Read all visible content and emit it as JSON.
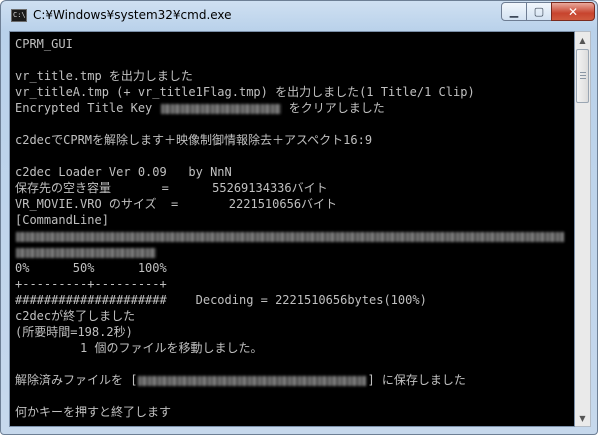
{
  "window": {
    "title": "C:¥Windows¥system32¥cmd.exe",
    "icon_text": "C:\\"
  },
  "controls": {
    "minimize_glyph": "▁",
    "maximize_glyph": "▢",
    "close_glyph": "✕"
  },
  "console": {
    "lines": [
      "CPRM_GUI",
      "",
      "vr_title.tmp を出力しました",
      "vr_titleA.tmp (+ vr_title1Flag.tmp) を出力しました(1 Title/1 Clip)",
      [
        "Encrypted Title Key ",
        {
          "blur": 120
        },
        " をクリアしました"
      ],
      "",
      "c2decでCPRMを解除します＋映像制御情報除去＋アスペクト16:9",
      "",
      "c2dec Loader Ver 0.09   by NnN",
      "保存先の空き容量       =      55269134336バイト",
      "VR_MOVIE.VRO のサイズ  =       2221510656バイト",
      "[CommandLine]",
      [
        {
          "blur": 548
        }
      ],
      [
        {
          "blur": 140
        }
      ],
      "0%      50%      100%",
      "+---------+---------+",
      "#####################    Decoding = 2221510656bytes(100%)",
      "c2decが終了しました",
      "(所要時間=198.2秒)",
      "         1 個のファイルを移動しました。",
      "",
      [
        "解除済みファイルを [",
        {
          "blur": 228
        },
        "] に保存しました"
      ],
      "",
      "何かキーを押すと終了します"
    ]
  },
  "scrollbar": {
    "up_glyph": "▲",
    "down_glyph": "▼"
  }
}
